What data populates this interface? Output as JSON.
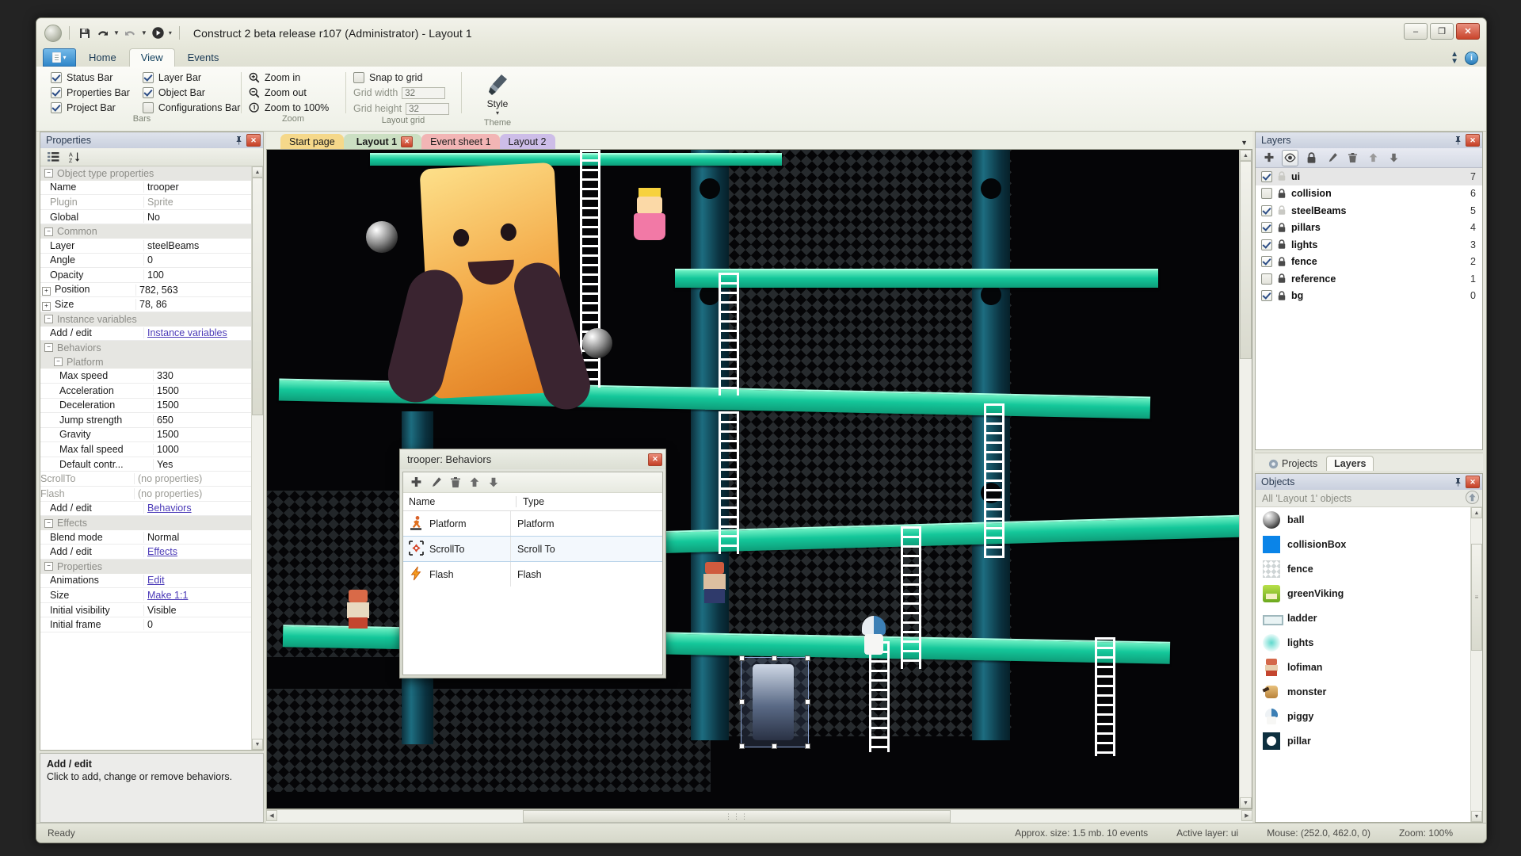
{
  "window": {
    "title": "Construct 2 beta release r107 (Administrator) - Layout 1",
    "minimize": "–",
    "maximize": "❐",
    "close": "✕",
    "quick_access": [
      "save-icon",
      "undo-icon",
      "redo-icon",
      "run-icon",
      "qat-dropdown-icon"
    ]
  },
  "ribbon": {
    "file_button": "file-menu-icon",
    "tabs": [
      {
        "label": "Home",
        "active": false
      },
      {
        "label": "View",
        "active": true
      },
      {
        "label": "Events",
        "active": false
      }
    ],
    "update_caret": "▲▼",
    "help_label": "i",
    "groups": [
      {
        "name": "Bars",
        "checkboxes": [
          {
            "label": "Status Bar",
            "checked": true
          },
          {
            "label": "Properties Bar",
            "checked": true
          },
          {
            "label": "Project Bar",
            "checked": true
          },
          {
            "label": "Layer Bar",
            "checked": true
          },
          {
            "label": "Object Bar",
            "checked": true
          },
          {
            "label": "Configurations Bar",
            "checked": false
          }
        ]
      },
      {
        "name": "Zoom",
        "items": [
          {
            "label": "Zoom in",
            "icon": "zoom-in-icon"
          },
          {
            "label": "Zoom out",
            "icon": "zoom-out-icon"
          },
          {
            "label": "Zoom to 100%",
            "icon": "zoom-100-icon"
          }
        ]
      },
      {
        "name": "Layout grid",
        "snap": {
          "label": "Snap to grid",
          "checked": false
        },
        "fields": [
          {
            "label": "Grid width",
            "value": "32"
          },
          {
            "label": "Grid height",
            "value": "32"
          }
        ]
      },
      {
        "name": "Theme",
        "style_label": "Style",
        "style_icon": "paintbrush-icon"
      }
    ]
  },
  "properties_panel": {
    "title": "Properties",
    "pin_icon": "pin-icon",
    "close_icon": "close-icon",
    "toolbar": [
      "categorize-icon",
      "sort-alpha-icon"
    ],
    "rows": [
      {
        "kind": "group",
        "name": "Object type properties",
        "expander": "−"
      },
      {
        "kind": "prop",
        "name": "Name",
        "value": "trooper",
        "indent": 1
      },
      {
        "kind": "prop",
        "name": "Plugin",
        "value": "Sprite",
        "indent": 1,
        "dim": true
      },
      {
        "kind": "prop",
        "name": "Global",
        "value": "No",
        "indent": 1
      },
      {
        "kind": "group",
        "name": "Common",
        "expander": "−"
      },
      {
        "kind": "prop",
        "name": "Layer",
        "value": "steelBeams",
        "indent": 1
      },
      {
        "kind": "prop",
        "name": "Angle",
        "value": "0",
        "indent": 1
      },
      {
        "kind": "prop",
        "name": "Opacity",
        "value": "100",
        "indent": 1
      },
      {
        "kind": "prop",
        "name": "Position",
        "value": "782, 563",
        "indent": 1,
        "expander": "+"
      },
      {
        "kind": "prop",
        "name": "Size",
        "value": "78, 86",
        "indent": 1,
        "expander": "+"
      },
      {
        "kind": "group",
        "name": "Instance variables",
        "expander": "−"
      },
      {
        "kind": "prop",
        "name": "Add / edit",
        "value": "Instance variables",
        "indent": 1,
        "link": true
      },
      {
        "kind": "group",
        "name": "Behaviors",
        "expander": "−"
      },
      {
        "kind": "group",
        "name": "Platform",
        "expander": "−",
        "indent": 1
      },
      {
        "kind": "prop",
        "name": "Max speed",
        "value": "330",
        "indent": 2
      },
      {
        "kind": "prop",
        "name": "Acceleration",
        "value": "1500",
        "indent": 2
      },
      {
        "kind": "prop",
        "name": "Deceleration",
        "value": "1500",
        "indent": 2
      },
      {
        "kind": "prop",
        "name": "Jump strength",
        "value": "650",
        "indent": 2
      },
      {
        "kind": "prop",
        "name": "Gravity",
        "value": "1500",
        "indent": 2
      },
      {
        "kind": "prop",
        "name": "Max fall speed",
        "value": "1000",
        "indent": 2
      },
      {
        "kind": "prop",
        "name": "Default contr...",
        "value": "Yes",
        "indent": 2
      },
      {
        "kind": "prop",
        "name": "ScrollTo",
        "value": "(no properties)",
        "indent": 0,
        "dim": true
      },
      {
        "kind": "prop",
        "name": "Flash",
        "value": "(no properties)",
        "indent": 0,
        "dim": true
      },
      {
        "kind": "prop",
        "name": "Add / edit",
        "value": "Behaviors",
        "indent": 1,
        "link": true
      },
      {
        "kind": "group",
        "name": "Effects",
        "expander": "−"
      },
      {
        "kind": "prop",
        "name": "Blend mode",
        "value": "Normal",
        "indent": 1
      },
      {
        "kind": "prop",
        "name": "Add / edit",
        "value": "Effects",
        "indent": 1,
        "link": true
      },
      {
        "kind": "group",
        "name": "Properties",
        "expander": "−"
      },
      {
        "kind": "prop",
        "name": "Animations",
        "value": "Edit",
        "indent": 1,
        "link": true
      },
      {
        "kind": "prop",
        "name": "Size",
        "value": "Make 1:1",
        "indent": 1,
        "link": true
      },
      {
        "kind": "prop",
        "name": "Initial visibility",
        "value": "Visible",
        "indent": 1
      },
      {
        "kind": "prop",
        "name": "Initial frame",
        "value": "0",
        "indent": 1
      }
    ],
    "help": {
      "title": "Add / edit",
      "text": "Click to add, change or remove behaviors."
    }
  },
  "document_tabs": [
    {
      "label": "Start page",
      "color": "#f5d88a",
      "active": false,
      "closable": false
    },
    {
      "label": "Layout 1",
      "color": "#cbdfc2",
      "active": true,
      "closable": true,
      "close_icon": "close-icon"
    },
    {
      "label": "Event sheet 1",
      "color": "#f2b5b5",
      "active": false,
      "closable": false
    },
    {
      "label": "Layout 2",
      "color": "#cdbde8",
      "active": false,
      "closable": false
    }
  ],
  "tab_overflow_icon": "chevron-down-icon",
  "behaviors_dialog": {
    "title": "trooper: Behaviors",
    "close_icon": "close-icon",
    "toolbar": [
      {
        "icon": "add-icon",
        "name": "add-behavior"
      },
      {
        "icon": "edit-pencil-icon",
        "name": "edit-behavior"
      },
      {
        "icon": "trash-icon",
        "name": "delete-behavior"
      },
      {
        "icon": "arrow-up-icon",
        "name": "move-up"
      },
      {
        "icon": "arrow-down-icon",
        "name": "move-down"
      }
    ],
    "columns": [
      "Name",
      "Type"
    ],
    "rows": [
      {
        "name": "Platform",
        "type": "Platform",
        "icon": "platform-runner-icon",
        "selected": false
      },
      {
        "name": "ScrollTo",
        "type": "Scroll To",
        "icon": "scrollto-icon",
        "selected": true
      },
      {
        "name": "Flash",
        "type": "Flash",
        "icon": "lightning-bolt-icon",
        "selected": false
      }
    ]
  },
  "layers_panel": {
    "title": "Layers",
    "pin_icon": "pin-icon",
    "close_icon": "close-icon",
    "toolbar": [
      {
        "icon": "add-icon",
        "name": "add-layer",
        "selected": false
      },
      {
        "icon": "eye-icon",
        "name": "toggle-visibility",
        "selected": true
      },
      {
        "icon": "lock-icon",
        "name": "toggle-lock",
        "selected": false
      },
      {
        "icon": "edit-pencil-icon",
        "name": "rename-layer",
        "selected": false
      },
      {
        "icon": "trash-icon",
        "name": "delete-layer",
        "selected": false
      },
      {
        "icon": "arrow-up-icon",
        "name": "move-layer-up",
        "selected": false
      },
      {
        "icon": "arrow-down-icon",
        "name": "move-layer-down",
        "selected": false
      }
    ],
    "layers": [
      {
        "name": "ui",
        "number": "7",
        "visible": true,
        "locked": false,
        "selected": true
      },
      {
        "name": "collision",
        "number": "6",
        "visible": false,
        "locked": true,
        "selected": false
      },
      {
        "name": "steelBeams",
        "number": "5",
        "visible": true,
        "locked": false,
        "selected": false
      },
      {
        "name": "pillars",
        "number": "4",
        "visible": true,
        "locked": true,
        "selected": false
      },
      {
        "name": "lights",
        "number": "3",
        "visible": true,
        "locked": true,
        "selected": false
      },
      {
        "name": "fence",
        "number": "2",
        "visible": true,
        "locked": true,
        "selected": false
      },
      {
        "name": "reference",
        "number": "1",
        "visible": false,
        "locked": true,
        "selected": false
      },
      {
        "name": "bg",
        "number": "0",
        "visible": true,
        "locked": true,
        "selected": false
      }
    ]
  },
  "panel_tabs": [
    {
      "label": "Projects",
      "active": false,
      "icon": "project-icon"
    },
    {
      "label": "Layers",
      "active": true,
      "icon": ""
    }
  ],
  "objects_panel": {
    "title": "Objects",
    "pin_icon": "pin-icon",
    "close_icon": "close-icon",
    "filter_label": "All 'Layout 1' objects",
    "up_icon": "up-folder-icon",
    "objects": [
      {
        "name": "ball",
        "icon": "ball-sprite"
      },
      {
        "name": "collisionBox",
        "icon": "collisionbox-sprite"
      },
      {
        "name": "fence",
        "icon": "fence-sprite"
      },
      {
        "name": "greenViking",
        "icon": "greenviking-sprite"
      },
      {
        "name": "ladder",
        "icon": "ladder-sprite"
      },
      {
        "name": "lights",
        "icon": "lights-sprite"
      },
      {
        "name": "lofiman",
        "icon": "lofiman-sprite"
      },
      {
        "name": "monster",
        "icon": "monster-sprite"
      },
      {
        "name": "piggy",
        "icon": "piggy-sprite"
      },
      {
        "name": "pillar",
        "icon": "pillar-sprite"
      }
    ]
  },
  "status_bar": {
    "ready": "Ready",
    "size": "Approx. size: 1.5 mb. 10 events",
    "active_layer": "Active layer: ui",
    "mouse": "Mouse: (252.0, 462.0, 0)",
    "zoom": "Zoom: 100%"
  },
  "colors": {
    "accent": "#2f86c9",
    "beam": "#14c79a",
    "close_red": "#c54026",
    "link": "#4c3bb8"
  }
}
